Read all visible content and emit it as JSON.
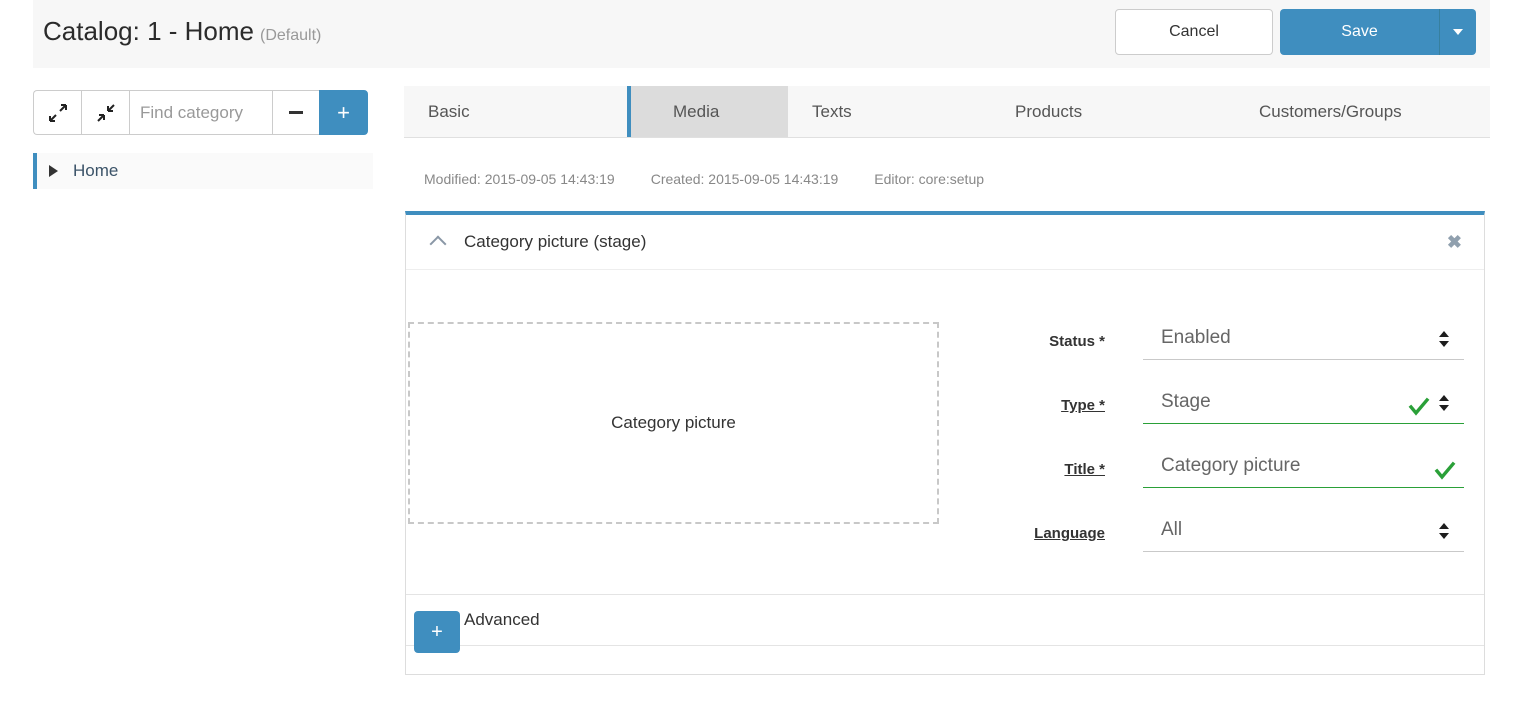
{
  "header": {
    "title": "Catalog: 1 - Home",
    "default_tag": "(Default)",
    "cancel_label": "Cancel",
    "save_label": "Save",
    "save_caret_icon": "chevron-down-icon",
    "accent_color": "#3f8ebf"
  },
  "sidebar": {
    "toolbar": {
      "expand_all_icon": "expand-arrows-icon",
      "collapse_all_icon": "collapse-arrows-icon",
      "search_placeholder": "Find category",
      "search_value": "",
      "remove_label": "−",
      "add_label": "+"
    },
    "tree": [
      {
        "label": "Home",
        "expander_icon": "triangle-right-icon",
        "selected": true
      }
    ]
  },
  "tabs": [
    {
      "label": "Basic",
      "active": false
    },
    {
      "label": "Media",
      "active": true
    },
    {
      "label": "Texts",
      "active": false
    },
    {
      "label": "Products",
      "active": false
    },
    {
      "label": "Customers/Groups",
      "active": false
    }
  ],
  "meta": {
    "modified": "Modified: 2015-09-05 14:43:19",
    "created": "Created: 2015-09-05 14:43:19",
    "editor": "Editor: core:setup"
  },
  "media_panel": {
    "collapse_icon": "chevron-up-icon",
    "title": "Category picture (stage)",
    "close_icon": "close-icon",
    "dropzone_text": "Category picture",
    "fields": {
      "status": {
        "label": "Status *",
        "value": "Enabled",
        "control": "select",
        "valid": false
      },
      "type": {
        "label": "Type *",
        "value": "Stage",
        "control": "select",
        "valid": true,
        "check_icon": "check-icon"
      },
      "title": {
        "label": "Title *",
        "value": "Category picture",
        "control": "input",
        "valid": true,
        "check_icon": "check-icon"
      },
      "language": {
        "label": "Language",
        "value": "All",
        "control": "select",
        "valid": false
      }
    },
    "advanced": {
      "label": "Advanced",
      "expand_icon": "chevron-down-icon"
    }
  },
  "add_block_button": {
    "label": "+",
    "icon": "plus-icon"
  },
  "colors": {
    "accent": "#3f8ebf",
    "valid_green": "#2aa038",
    "active_tab_bg": "#dcdcdc",
    "header_bg": "#f7f7f7"
  }
}
